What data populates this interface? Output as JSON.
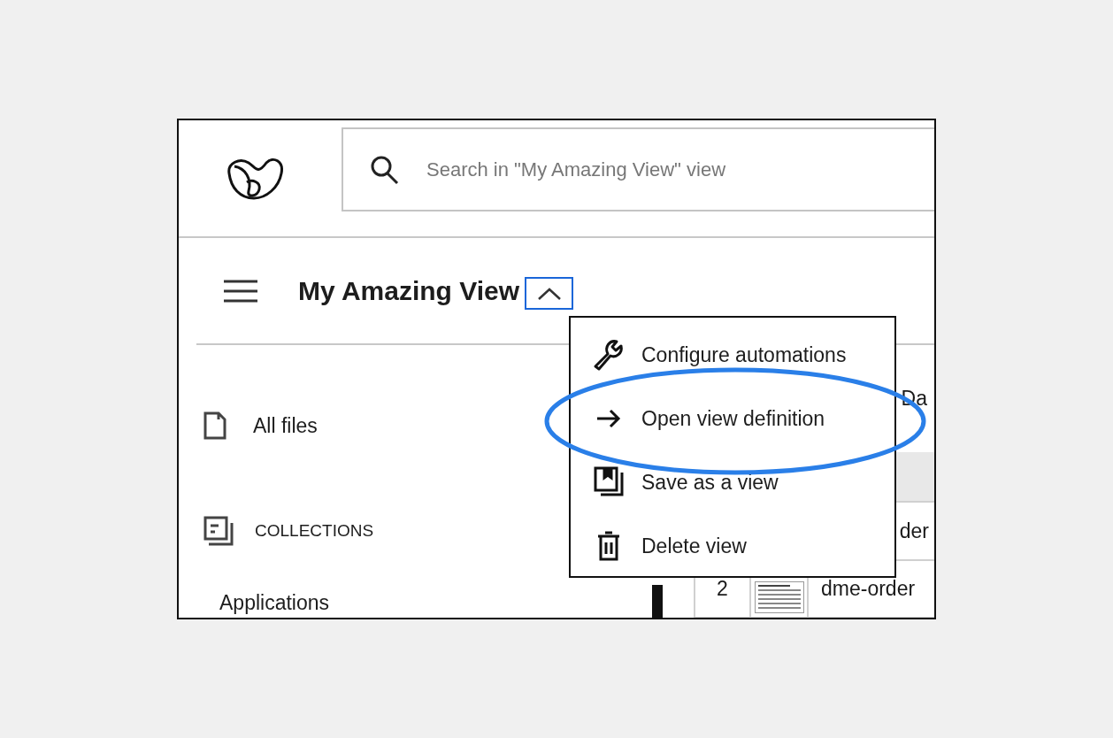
{
  "header": {
    "search": {
      "placeholder": "Search in \"My Amazing View\" view"
    }
  },
  "view": {
    "title": "My Amazing View",
    "menu_button": {
      "expanded": true,
      "focused": true
    }
  },
  "sidebar": {
    "items": [
      {
        "kind": "file",
        "label": "All files"
      },
      {
        "kind": "section",
        "label": "COLLECTIONS"
      },
      {
        "kind": "plain",
        "label": "Applications"
      }
    ]
  },
  "table": {
    "columns": [
      "Da"
    ],
    "rows": [
      {
        "number": "",
        "thumbnail": false,
        "name": "der"
      },
      {
        "number": "2",
        "thumbnail": true,
        "name": "dme-order"
      }
    ]
  },
  "menu": {
    "items": [
      {
        "kind": "wrench",
        "label": "Configure automations",
        "highlighted": false
      },
      {
        "kind": "arrow",
        "label": "Open view definition",
        "highlighted": true
      },
      {
        "kind": "save",
        "label": "Save as a view",
        "highlighted": false
      },
      {
        "kind": "trash",
        "label": "Delete view",
        "highlighted": false
      }
    ]
  }
}
